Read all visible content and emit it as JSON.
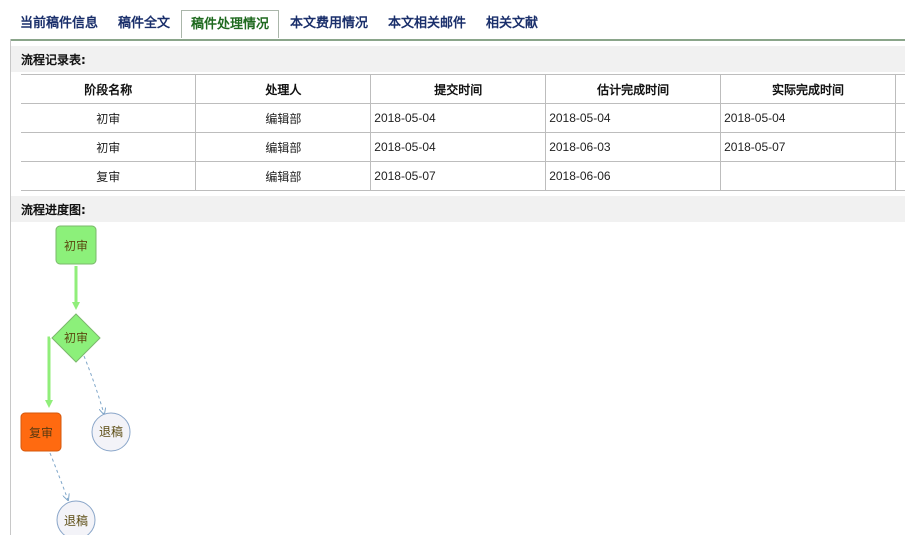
{
  "tabs": [
    {
      "label": "当前稿件信息",
      "active": false
    },
    {
      "label": "稿件全文",
      "active": false
    },
    {
      "label": "稿件处理情况",
      "active": true
    },
    {
      "label": "本文费用情况",
      "active": false
    },
    {
      "label": "本文相关邮件",
      "active": false
    },
    {
      "label": "相关文献",
      "active": false
    }
  ],
  "records": {
    "title": "流程记录表:",
    "columns": [
      "阶段名称",
      "处理人",
      "提交时间",
      "估计完成时间",
      "实际完成时间"
    ],
    "rows": [
      [
        "初审",
        "编辑部",
        "2018-05-04",
        "2018-05-04",
        "2018-05-04"
      ],
      [
        "初审",
        "编辑部",
        "2018-05-04",
        "2018-06-03",
        "2018-05-07"
      ],
      [
        "复审",
        "编辑部",
        "2018-05-07",
        "2018-06-06",
        ""
      ]
    ]
  },
  "progress": {
    "title": "流程进度图:",
    "nodes": {
      "start": "初审",
      "decision": "初审",
      "reject1": "退稿",
      "review2": "复审",
      "reject2": "退稿"
    }
  },
  "colors": {
    "tab_text": "#1a2f6b",
    "tab_active_text": "#1f6a1f",
    "node_green": "#8cf07a",
    "node_orange": "#ff6a10",
    "arrow_green": "#90ee7a",
    "arrow_dashed": "#7fa6c9"
  }
}
